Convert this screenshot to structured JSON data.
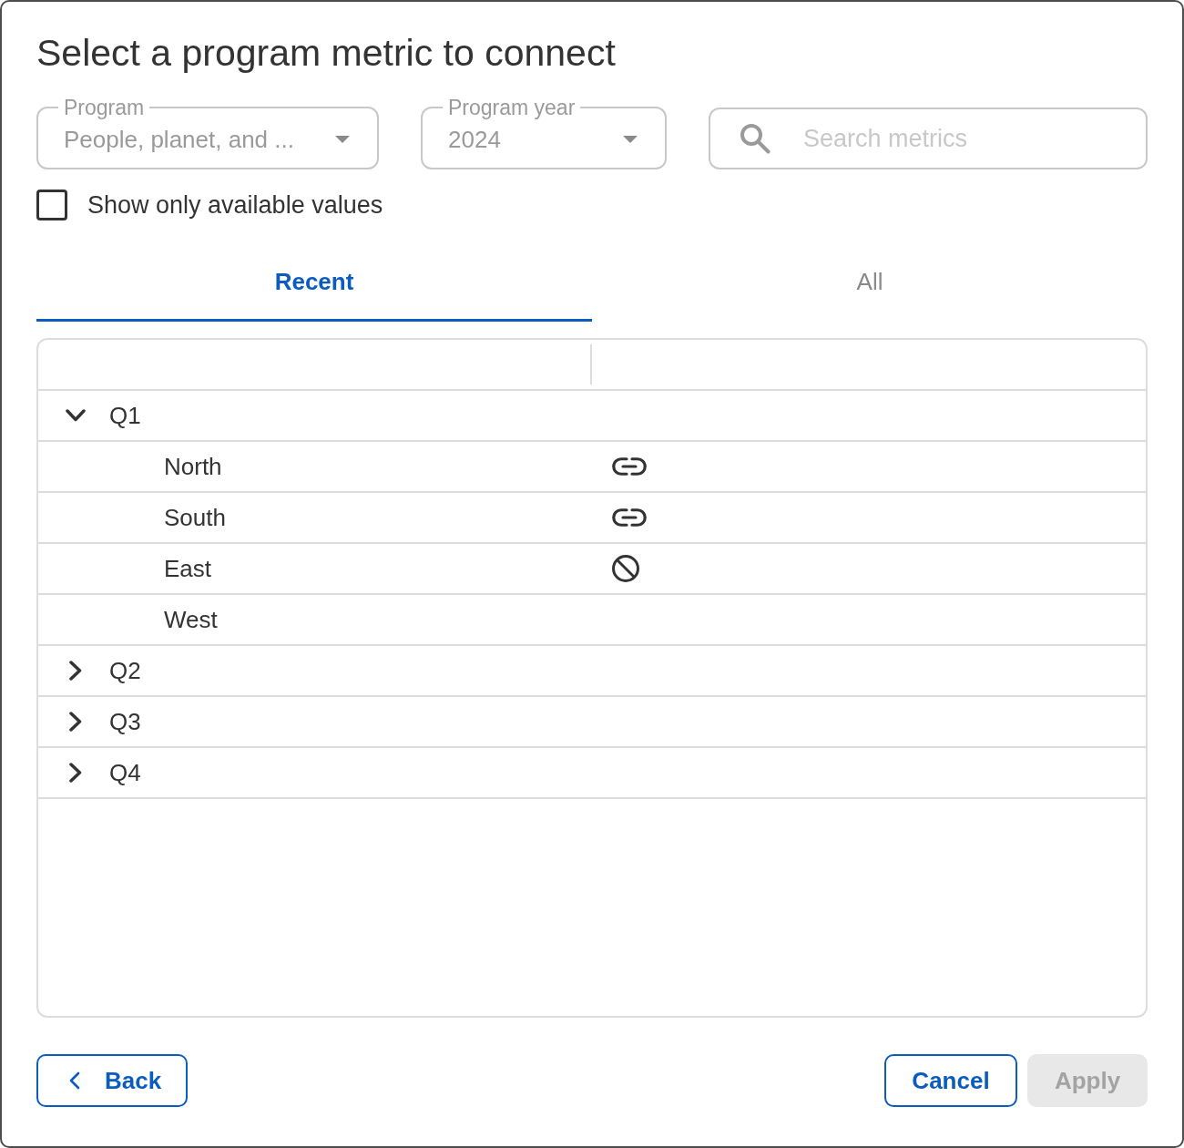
{
  "dialog": {
    "title": "Select a program metric to connect"
  },
  "filters": [
    {
      "kind": "select",
      "label": "Program",
      "value": "People, planet, and ..."
    },
    {
      "kind": "select",
      "label": "Program year",
      "value": "2024"
    },
    {
      "kind": "search",
      "placeholder": "Search metrics"
    }
  ],
  "available_only": {
    "label": "Show only available values",
    "checked": false
  },
  "tabs": [
    {
      "label": "Recent",
      "selected": true
    },
    {
      "label": "All",
      "selected": false
    }
  ],
  "tree": {
    "rows": [
      {
        "label": "Q1",
        "expanded": true,
        "children": [
          {
            "label": "North",
            "kind": "linked"
          },
          {
            "label": "South",
            "kind": "linked"
          },
          {
            "label": "East",
            "kind": "blocked"
          },
          {
            "label": "West",
            "kind": "plain"
          }
        ]
      },
      {
        "label": "Q2",
        "expanded": false
      },
      {
        "label": "Q3",
        "expanded": false
      },
      {
        "label": "Q4",
        "expanded": false
      }
    ]
  },
  "buttons": [
    {
      "kind": "back",
      "label": "Back",
      "disabled": false
    },
    {
      "kind": "outline",
      "label": "Cancel",
      "disabled": false
    },
    {
      "kind": "primary",
      "label": "Apply",
      "disabled": true
    }
  ]
}
